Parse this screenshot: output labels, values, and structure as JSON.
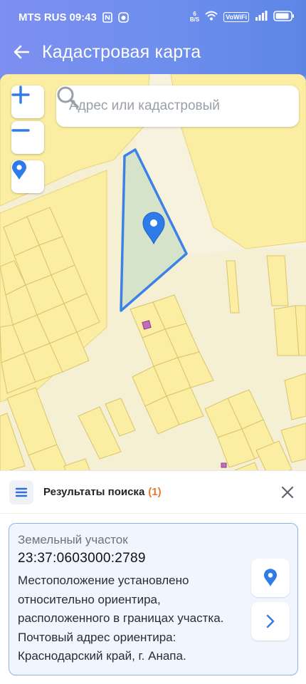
{
  "status_bar": {
    "carrier": "MTS RUS",
    "time": "09:43",
    "net_speed_top": "6",
    "net_speed_bottom": "B/S",
    "volte": "VoWiFi",
    "icons": [
      "nfc-icon",
      "app-notification-icon",
      "wifi-icon",
      "signal-icon",
      "battery-icon"
    ]
  },
  "app_bar": {
    "title": "Кадастровая карта",
    "back_icon": "arrow-left-icon"
  },
  "map": {
    "search_placeholder": "Адрес или кадастровый",
    "search_icon": "search-icon",
    "zoom_in_icon": "plus-icon",
    "zoom_out_icon": "minus-icon",
    "locate_icon": "location-pin-icon",
    "selected_parcel_color": "#3c82e6",
    "parcel_fill_color": "#fbeea2",
    "accent_color": "#2f7bea"
  },
  "results": {
    "title": "Результаты поиска",
    "count": "(1)",
    "menu_icon": "list-menu-icon",
    "close_icon": "close-icon",
    "items": [
      {
        "type": "Земельный участок",
        "number": "23:37:0603000:2789",
        "description": "Местоположение установлено относительно ориентира, расположенного в границах участка. Почтовый адрес ориентира: Краснодарский край, г. Анапа.",
        "show_on_map_icon": "location-pin-icon",
        "details_icon": "chevron-right-icon"
      }
    ]
  }
}
